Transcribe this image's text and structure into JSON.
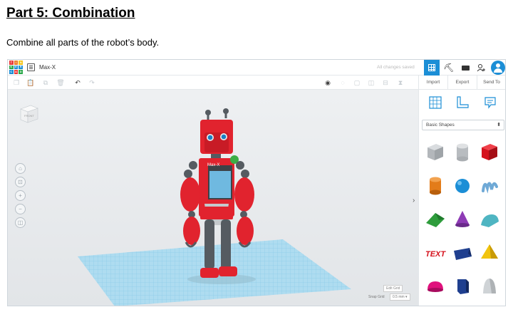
{
  "document": {
    "title": "Part 5: Combination",
    "subtitle": "Combine all parts of the robot’s body."
  },
  "app": {
    "logo_letters": [
      "T",
      "I",
      "N",
      "K",
      "E",
      "R",
      "C",
      "A",
      "D"
    ],
    "logo_colors": [
      "#e93b3b",
      "#ee7a27",
      "#f5c518",
      "#2aa84a",
      "#1b8ed6",
      "#1b8ed6",
      "#1b8ed6",
      "#e93b3b",
      "#2aa84a"
    ],
    "project_name": "Max-X",
    "save_status": "All changes saved",
    "accent_color": "#1b8ed6"
  },
  "panel_tabs": [
    "Import",
    "Export",
    "Send To"
  ],
  "viewcube_label": "FRONT",
  "workplane": {
    "edit_grid_label": "Edit Grid",
    "snap_grid_label": "Snap Grid",
    "snap_grid_value": "0.5 mm ▾"
  },
  "robot": {
    "chest_label": "Max-X",
    "body_color": "#e1232e",
    "joint_color": "#555b61",
    "eye_color": "#1b7fc4"
  },
  "shapes_panel": {
    "category": "Basic Shapes",
    "category_arrow": "⬍",
    "shapes": [
      {
        "name": "box-hole",
        "color": "#b8bcc0"
      },
      {
        "name": "cylinder-hole",
        "color": "#b8bcc0"
      },
      {
        "name": "box",
        "color": "#d5121d"
      },
      {
        "name": "cylinder",
        "color": "#e37c1a"
      },
      {
        "name": "sphere",
        "color": "#1b8ed6"
      },
      {
        "name": "scribble",
        "color": "#6fa9d6"
      },
      {
        "name": "roof",
        "color": "#2e9c3c"
      },
      {
        "name": "cone",
        "color": "#8e3bb5"
      },
      {
        "name": "round-roof",
        "color": "#4fb5c2"
      },
      {
        "name": "text",
        "color": "#d5121d",
        "text": "TEXT"
      },
      {
        "name": "wedge",
        "color": "#1f3f8f"
      },
      {
        "name": "pyramid",
        "color": "#f1c40f"
      },
      {
        "name": "half-sphere",
        "color": "#e0117d"
      },
      {
        "name": "polygon",
        "color": "#1f3f8f"
      },
      {
        "name": "paraboloid",
        "color": "#cfd3d6"
      }
    ]
  }
}
